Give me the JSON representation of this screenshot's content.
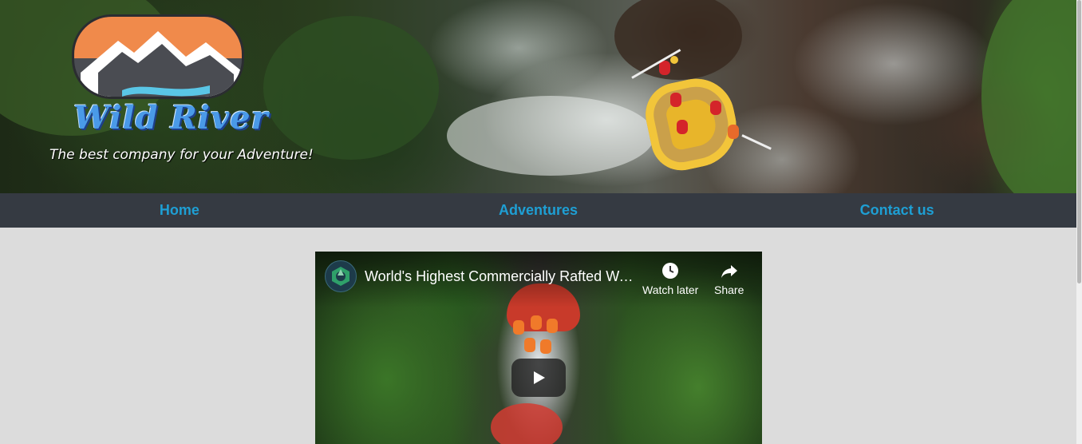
{
  "brand": {
    "name": "Wild River",
    "tagline": "The best company for your Adventure!"
  },
  "nav": {
    "items": [
      {
        "label": "Home"
      },
      {
        "label": "Adventures"
      },
      {
        "label": "Contact us"
      }
    ]
  },
  "video": {
    "title": "World's Highest Commercially Rafted Waterfall",
    "watch_later_label": "Watch later",
    "share_label": "Share",
    "icons": [
      "channel-logo-icon",
      "clock-icon",
      "share-arrow-icon",
      "play-icon"
    ]
  },
  "colors": {
    "nav_background": "#353a42",
    "nav_link": "#1e9fd4",
    "page_background": "#dcdcdc",
    "logo_text": "#4a9ae8",
    "logo_sky": "#f08a4b"
  }
}
